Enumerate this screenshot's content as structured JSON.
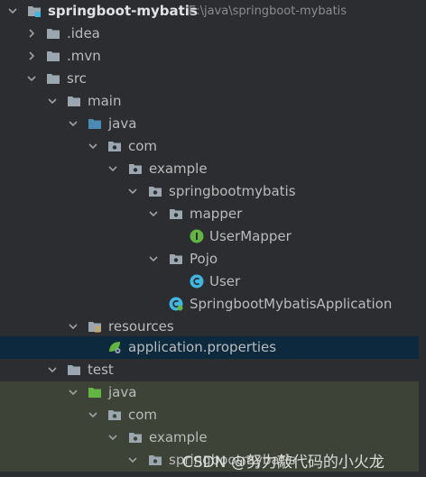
{
  "tree": {
    "root": {
      "name": "springboot-mybatis",
      "path": "E:\\java\\springboot-mybatis"
    },
    "idea": ".idea",
    "mvn": ".mvn",
    "src": "src",
    "main": "main",
    "java": "java",
    "com": "com",
    "example": "example",
    "springbootmybatis": "springbootmybatis",
    "mapper": "mapper",
    "usermapper": "UserMapper",
    "pojo": "Pojo",
    "user": "User",
    "application_class": "SpringbootMybatisApplication",
    "resources": "resources",
    "application_properties": "application.properties",
    "test": "test",
    "test_java": "java",
    "test_com": "com",
    "test_example": "example",
    "test_springbootmybatis": "springbootmybatis"
  },
  "watermark": "CSDN @努力敲代码的小火龙",
  "colors": {
    "background": "#2b2d30",
    "selected_row": "#0d293e",
    "test_zone": "#3d4437",
    "folder": "#9aa7b0",
    "source_folder": "#4a8ab5",
    "test_folder": "#62b543",
    "interface_icon": "#62b543",
    "class_icon": "#40b6e0"
  }
}
